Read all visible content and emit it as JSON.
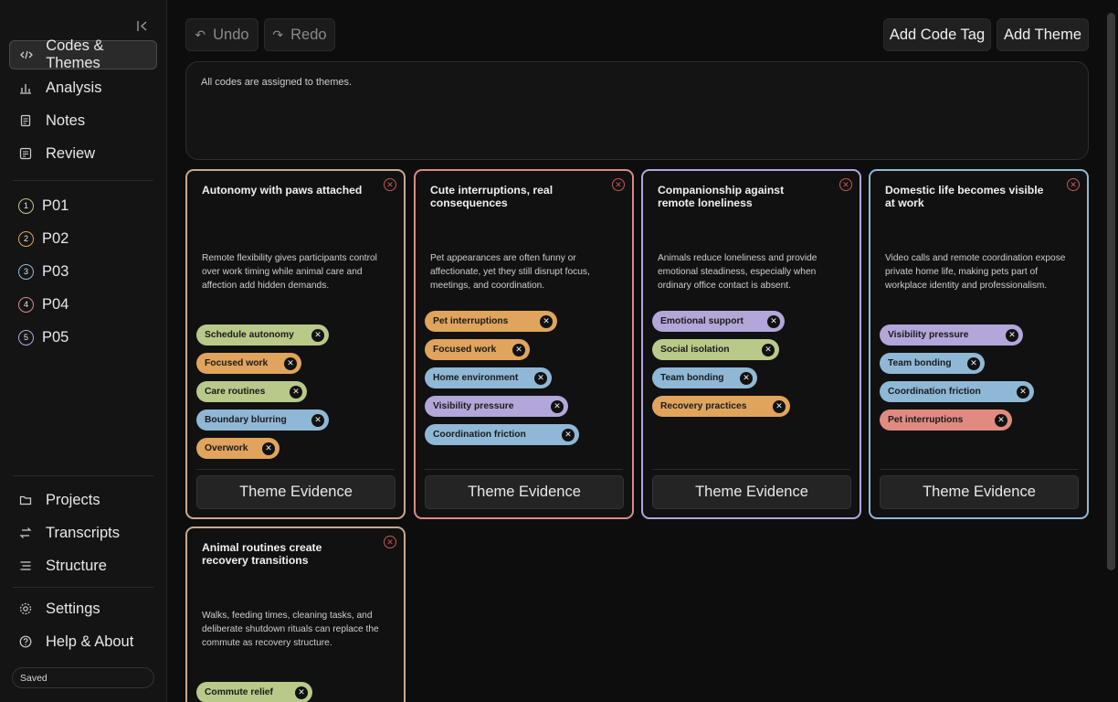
{
  "sidebar": {
    "nav_top": [
      {
        "label": "Codes & Themes",
        "icon": "code-icon",
        "active": true
      },
      {
        "label": "Analysis",
        "icon": "bar-chart-icon"
      },
      {
        "label": "Notes",
        "icon": "notes-icon"
      },
      {
        "label": "Review",
        "icon": "review-icon"
      }
    ],
    "participants": [
      {
        "badge": "1",
        "label": "P01",
        "color": "#b9c98a"
      },
      {
        "badge": "2",
        "label": "P02",
        "color": "#e0a45c"
      },
      {
        "badge": "3",
        "label": "P03",
        "color": "#8fb8d6"
      },
      {
        "badge": "4",
        "label": "P04",
        "color": "#d98a8a"
      },
      {
        "badge": "5",
        "label": "P05",
        "color": "#b3a6d9"
      }
    ],
    "nav_mid": [
      {
        "label": "Projects",
        "icon": "folder-icon"
      },
      {
        "label": "Transcripts",
        "icon": "swap-icon"
      },
      {
        "label": "Structure",
        "icon": "structure-icon"
      }
    ],
    "nav_bottom": [
      {
        "label": "Settings",
        "icon": "gear-icon"
      },
      {
        "label": "Help & About",
        "icon": "help-icon"
      }
    ],
    "status": "Saved"
  },
  "toolbar": {
    "undo": "Undo",
    "redo": "Redo",
    "add_code_tag": "Add Code Tag",
    "add_theme": "Add Theme"
  },
  "notice": "All codes are assigned to themes.",
  "themes": [
    {
      "title": "Autonomy with paws attached",
      "border": "#c9a98f",
      "description": "Remote flexibility gives participants control over work timing while animal care and affection add hidden demands.",
      "tags": [
        {
          "label": "Schedule autonomy",
          "color": "#b9c98a"
        },
        {
          "label": "Focused work",
          "color": "#e0a45c"
        },
        {
          "label": "Care routines",
          "color": "#b9c98a"
        },
        {
          "label": "Boundary blurring",
          "color": "#8fb8d6"
        },
        {
          "label": "Overwork",
          "color": "#e0a45c"
        }
      ],
      "evidence": "Theme Evidence"
    },
    {
      "title": "Cute interruptions, real consequences",
      "border": "#d98a8a",
      "description": "Pet appearances are often funny or affectionate, yet they still disrupt focus, meetings, and coordination.",
      "tags": [
        {
          "label": "Pet interruptions",
          "color": "#e0a45c"
        },
        {
          "label": "Focused work",
          "color": "#e0a45c"
        },
        {
          "label": "Home environment",
          "color": "#8fb8d6"
        },
        {
          "label": "Visibility pressure",
          "color": "#b3a6d9"
        },
        {
          "label": "Coordination friction",
          "color": "#8fb8d6"
        }
      ],
      "evidence": "Theme Evidence"
    },
    {
      "title": "Companionship against remote loneliness",
      "border": "#b3a6d9",
      "description": "Animals reduce loneliness and provide emotional steadiness, especially when ordinary office contact is absent.",
      "tags": [
        {
          "label": "Emotional support",
          "color": "#b3a6d9"
        },
        {
          "label": "Social isolation",
          "color": "#b9c98a"
        },
        {
          "label": "Team bonding",
          "color": "#8fb8d6"
        },
        {
          "label": "Recovery practices",
          "color": "#e0a45c"
        }
      ],
      "evidence": "Theme Evidence"
    },
    {
      "title": "Domestic life becomes visible at work",
      "border": "#8fb8d6",
      "description": "Video calls and remote coordination expose private home life, making pets part of workplace identity and professionalism.",
      "tags": [
        {
          "label": "Visibility pressure",
          "color": "#b3a6d9"
        },
        {
          "label": "Team bonding",
          "color": "#8fb8d6"
        },
        {
          "label": "Coordination friction",
          "color": "#8fb8d6"
        },
        {
          "label": "Pet interruptions",
          "color": "#e08a80"
        }
      ],
      "evidence": "Theme Evidence"
    },
    {
      "title": "Animal routines create recovery transitions",
      "border": "#c9a98f",
      "description": "Walks, feeding times, cleaning tasks, and deliberate shutdown rituals can replace the commute as recovery structure.",
      "tags": [
        {
          "label": "Commute relief",
          "color": "#b9c98a"
        }
      ],
      "evidence": ""
    }
  ]
}
